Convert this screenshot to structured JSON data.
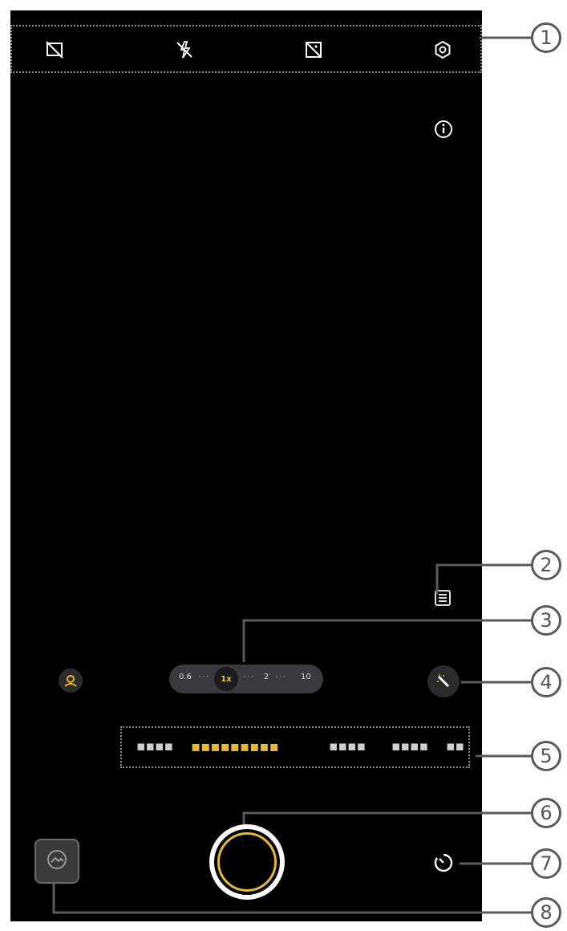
{
  "top_bar": {
    "icons": [
      "hdr-off-icon",
      "flash-off-icon",
      "ai-scene-off-icon",
      "settings-icon"
    ]
  },
  "viewfinder": {
    "info_icon": "info-icon",
    "menu_icon": "filter-menu-icon"
  },
  "zoom": {
    "levels": [
      "0.6",
      "1x",
      "2",
      "10"
    ],
    "selected": "1x",
    "separator": "···"
  },
  "controls": {
    "portrait_icon": "portrait-icon",
    "beauty_icon": "magic-wand-icon",
    "timer_icon": "timer-icon",
    "gallery_icon": "gallery-icon"
  },
  "modes": {
    "items": [
      "▪▪▪▪",
      "▪▪▪▪▪▪▪▪▪",
      "▪▪▪▪",
      "▪▪▪▪",
      "▪▪"
    ],
    "active_index": 1
  },
  "callouts": [
    "1",
    "2",
    "3",
    "4",
    "5",
    "6",
    "7",
    "8"
  ],
  "colors": {
    "accent": "#e3b931",
    "background": "#000000",
    "pill": "#3a3a3c"
  }
}
